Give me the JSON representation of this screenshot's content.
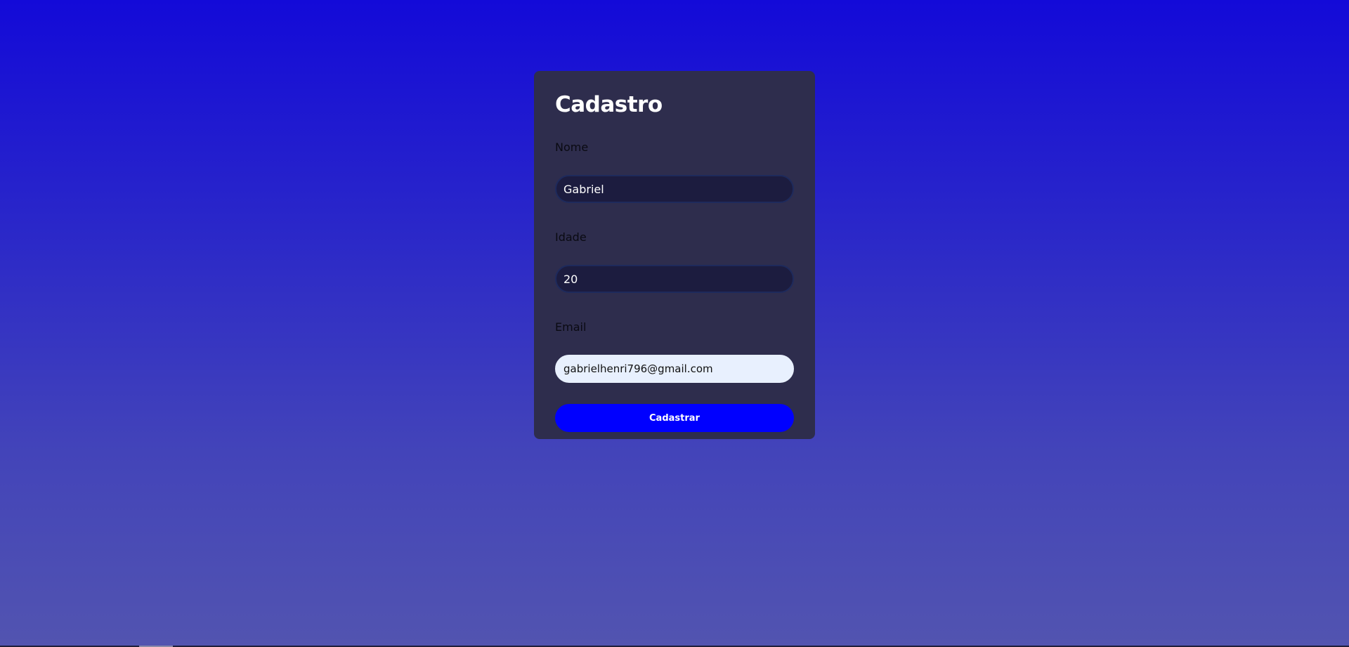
{
  "form": {
    "title": "Cadastro",
    "fields": [
      {
        "label": "Nome",
        "value": "Gabriel"
      },
      {
        "label": "Idade",
        "value": "20"
      },
      {
        "label": "Email",
        "value": "gabrielhenri796@gmail.com"
      }
    ],
    "submit_label": "Cadastrar"
  },
  "colors": {
    "background_top": "#130ad8",
    "background_bottom": "#5254b0",
    "card": "#2e2d4d",
    "input": "#1c1c3f",
    "input_autofill": "#e8f0fe",
    "button": "#0000ff"
  }
}
